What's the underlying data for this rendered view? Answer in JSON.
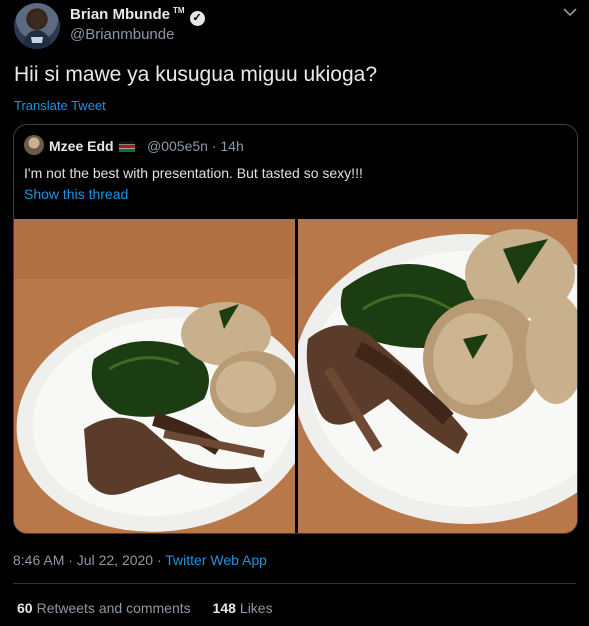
{
  "author": {
    "name": "Brian Mbunde",
    "tm": "TM",
    "verified_mark": "✓",
    "handle": "@Brianmbunde"
  },
  "tweet": {
    "text": "Hii si mawe ya kusugua miguu ukioga?",
    "translate_label": "Translate Tweet"
  },
  "quoted": {
    "name": "Mzee Edd",
    "handle": "@005e5n · 14h",
    "text": "I'm not the best with presentation. But tasted so sexy!!!",
    "show_thread": "Show this thread"
  },
  "meta": {
    "time_date": "8:46 AM · Jul 22, 2020 · ",
    "app": "Twitter Web App"
  },
  "stats": {
    "retweets_count": "60",
    "retweets_label": "Retweets and comments",
    "likes_count": "148",
    "likes_label": "Likes"
  },
  "icons": {
    "caret": "chevron-down-icon",
    "verified": "verified-badge-icon",
    "flag": "kenya-flag-icon"
  },
  "colors": {
    "background": "#000000",
    "link": "#1b95e0",
    "secondary_text": "#8b98a5",
    "table_wood": "#b7774a"
  }
}
